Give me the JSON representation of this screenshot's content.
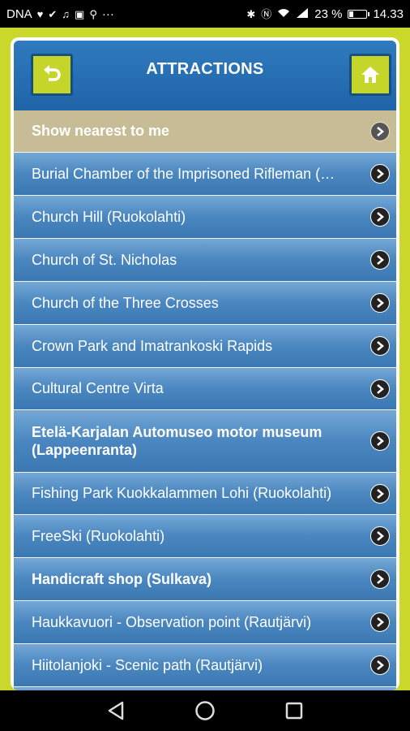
{
  "status": {
    "carrier": "DNA",
    "battery": "23 %",
    "battery_level": 0.23,
    "time": "14.33",
    "more": "···"
  },
  "header": {
    "title": "ATTRACTIONS"
  },
  "list": {
    "items": [
      {
        "label": "Show nearest to me"
      },
      {
        "label": "Burial Chamber of the Imprisoned Rifleman (…"
      },
      {
        "label": "Church Hill (Ruokolahti)"
      },
      {
        "label": "Church of St. Nicholas"
      },
      {
        "label": "Church of the Three Crosses"
      },
      {
        "label": "Crown Park and Imatrankoski Rapids"
      },
      {
        "label": "Cultural Centre Virta"
      },
      {
        "label": "Etelä-Karjalan Automuseo motor museum (Lappeenranta)"
      },
      {
        "label": "Fishing Park Kuokkalammen Lohi (Ruokolahti)"
      },
      {
        "label": "FreeSki (Ruokolahti)"
      },
      {
        "label": "Handicraft shop (Sulkava)"
      },
      {
        "label": "Haukkavuori - Observation point (Rautjärvi)"
      },
      {
        "label": "Hiitolanjoki - Scenic path (Rautjärvi)"
      },
      {
        "label": ""
      }
    ]
  },
  "colors": {
    "accent": "#c6d52a",
    "header": "#1f63a8",
    "row": "#4a86bf",
    "nearest": "#c8bc96"
  }
}
